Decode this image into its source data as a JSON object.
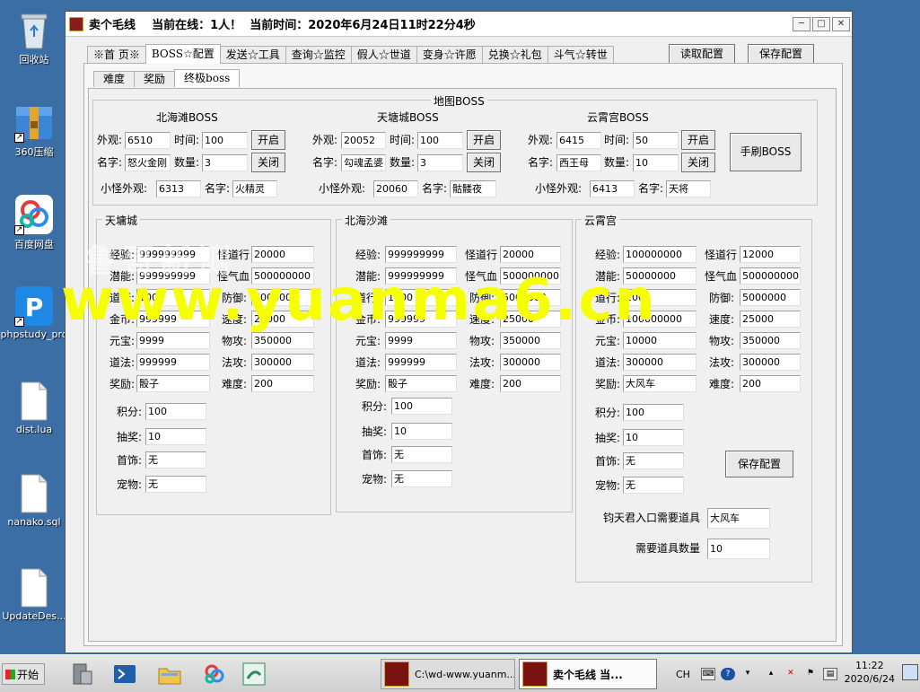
{
  "desktop": {
    "icons": [
      {
        "label": "回收站",
        "icon": "recycle-bin-icon"
      },
      {
        "label": "360压缩",
        "icon": "archive-folder-icon"
      },
      {
        "label": "百度网盘",
        "icon": "baidu-netdisk-icon"
      },
      {
        "label": "phpstudy_pro",
        "icon": "phpstudy-icon"
      },
      {
        "label": "dist.lua",
        "icon": "file-icon"
      },
      {
        "label": "nanako.sql",
        "icon": "file-icon"
      },
      {
        "label": "UpdateDes...",
        "icon": "file-icon"
      }
    ]
  },
  "window": {
    "title": "卖个毛线    当前在线：1人！  当前时间：2020年6月24日11时22分4秒",
    "controls": {
      "minimize": "─",
      "restore": "□",
      "close": "✕"
    }
  },
  "main_tabs": [
    "※首 页※",
    "BOSS☆配置",
    "发送☆工具",
    "查询☆监控",
    "假人☆世道",
    "变身☆许愿",
    "兑换☆礼包",
    "斗气☆转世"
  ],
  "main_active": 1,
  "toolbar": {
    "load_config": "读取配置",
    "save_config": "保存配置"
  },
  "sub_tabs": [
    "难度",
    "奖励",
    "终极boss"
  ],
  "sub_active": 2,
  "map_boss": {
    "title": "地图BOSS",
    "labels": {
      "appearance": "外观:",
      "time": "时间:",
      "name": "名字:",
      "count": "数量:",
      "open": "开启",
      "close": "关闭",
      "minion_appearance": "小怪外观:",
      "minion_name": "名字:"
    },
    "bosses": [
      {
        "title": "北海滩BOSS",
        "appearance": "6510",
        "time": "100",
        "name": "怒火金刚",
        "count": "3",
        "minion_appearance": "6313",
        "minion_name": "火精灵"
      },
      {
        "title": "天塘城BOSS",
        "appearance": "20052",
        "time": "100",
        "name": "勾魂孟婆",
        "count": "3",
        "minion_appearance": "20060",
        "minion_name": "骷髅夜",
        "fill": 1
      },
      {
        "title": "云霄宫BOSS",
        "appearance": "6415",
        "time": "50",
        "name": "西王母",
        "count": "10",
        "minion_appearance": "6413",
        "minion_name": "天将"
      }
    ],
    "manual_button": "手刷BOSS"
  },
  "stat_labels": {
    "exp": "经验:",
    "potential": "潜能:",
    "daoxing": "道行:",
    "gold": "金币:",
    "yuanbao": "元宝:",
    "daofa": "道法:",
    "reward": "奖励:",
    "m_daoxing": "怪道行",
    "m_qixue": "怪气血",
    "defense": "防御:",
    "speed": "速度:",
    "atk": "物攻:",
    "matk": "法攻:",
    "difficulty": "难度:",
    "points": "积分:",
    "lottery": "抽奖:",
    "accessory": "首饰:",
    "pet": "宠物:"
  },
  "zones": [
    {
      "title": "天墉城",
      "exp": "999999999",
      "potential": "999999999",
      "daoxing": "1000",
      "gold": "999999",
      "yuanbao": "9999",
      "daofa": "999999",
      "reward": "骰子",
      "m_daoxing": "20000",
      "m_qixue": "500000000",
      "defense": "5000000",
      "speed": "25000",
      "atk": "350000",
      "matk": "300000",
      "difficulty": "200",
      "points": "100",
      "lottery": "10",
      "accessory": "无",
      "pet": "无"
    },
    {
      "title": "北海沙滩",
      "exp": "999999999",
      "potential": "999999999",
      "daoxing": "1000",
      "gold": "999999",
      "yuanbao": "9999",
      "daofa": "999999",
      "reward": "骰子",
      "m_daoxing": "20000",
      "m_qixue": "500000000",
      "defense": "5000000",
      "speed": "25000",
      "atk": "350000",
      "matk": "300000",
      "difficulty": "200",
      "points": "100",
      "lottery": "10",
      "accessory": "无",
      "pet": "无"
    },
    {
      "title": "云霄宫",
      "exp": "100000000",
      "potential": "50000000",
      "daoxing": "1000",
      "gold": "100000000",
      "yuanbao": "10000",
      "daofa": "300000",
      "reward": "大风车",
      "m_daoxing": "12000",
      "m_qixue": "500000000",
      "defense": "5000000",
      "speed": "25000",
      "atk": "350000",
      "matk": "300000",
      "difficulty": "200",
      "points": "100",
      "lottery": "10",
      "accessory": "无",
      "pet": "无"
    }
  ],
  "yunxiao_extra": {
    "save_button": "保存配置",
    "entry_item_label": "钧天君入口需要道具",
    "entry_item_value": "大风车",
    "item_count_label": "需要道具数量",
    "item_count_value": "10"
  },
  "watermark": {
    "line1": "鲁哥新测",
    "line2": "www.yuanma6.cn"
  },
  "taskbar": {
    "start": "开始",
    "tasks": [
      {
        "label": "C:\\wd-www.yuanm..."
      },
      {
        "label": "卖个毛线    当..."
      }
    ],
    "tray": {
      "lang": "CH",
      "time": "11:22",
      "date": "2020/6/24"
    }
  }
}
